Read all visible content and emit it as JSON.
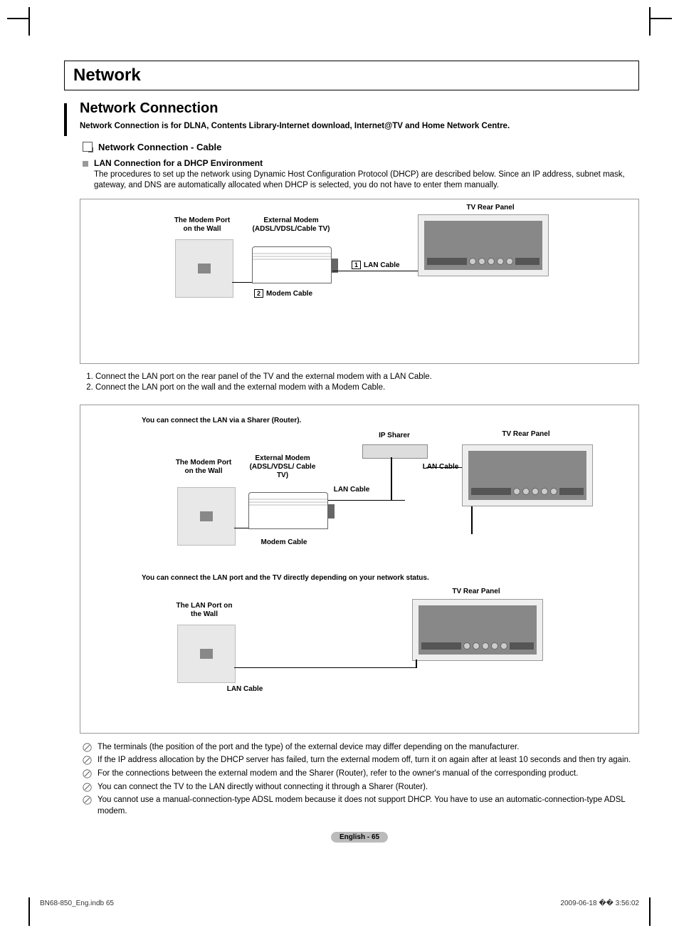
{
  "section": {
    "title": "Network"
  },
  "subsection": {
    "title": "Network Connection",
    "description": "Network Connection is for DLNA, Contents Library-Internet download, Internet@TV and Home Network Centre."
  },
  "cable_section": {
    "title": "Network Connection - Cable",
    "lan_dhcp_title": "LAN Connection for a DHCP Environment",
    "lan_dhcp_body": "The procedures to set up the network using Dynamic Host Configuration Protocol (DHCP) are described below. Since an IP address, subnet mask, gateway, and DNS are automatically allocated when DHCP is selected, you do not have to enter them manually."
  },
  "diagram1": {
    "modem_port_label": "The Modem Port on the Wall",
    "external_modem_label": "External Modem (ADSL/VDSL/Cable TV)",
    "tv_rear_label": "TV Rear Panel",
    "lan_cable_num": "1",
    "lan_cable_label": "LAN Cable",
    "modem_cable_num": "2",
    "modem_cable_label": "Modem Cable"
  },
  "steps": {
    "s1_num": "1.",
    "s1": "Connect the LAN port on the rear panel of the TV and the external modem with a LAN Cable.",
    "s2_num": "2.",
    "s2": "Connect the LAN port on the wall and the external modem with a Modem Cable."
  },
  "diagram2": {
    "caption1": "You can connect the LAN via a Sharer (Router).",
    "modem_port_label": "The Modem Port on the Wall",
    "external_modem_label": "External Modem (ADSL/VDSL/ Cable TV)",
    "ip_sharer_label": "IP Sharer",
    "tv_rear_label": "TV Rear Panel",
    "lan_cable_label": "LAN Cable",
    "modem_cable_label": "Modem Cable",
    "caption2": "You can connect the LAN port and the TV directly depending on your network status.",
    "lan_port_label": "The LAN Port on the Wall",
    "lan_cable_label2": "LAN Cable",
    "tv_rear_label2": "TV Rear Panel"
  },
  "notes": {
    "n1": "The terminals (the position of the port and the type) of the external device may differ depending on the manufacturer.",
    "n2": "If the IP address allocation by the DHCP server has failed, turn the external modem off, turn it on again after at least 10 seconds and then try again.",
    "n3": "For the connections between the external modem and the Sharer (Router), refer to the owner's manual of the corresponding product.",
    "n4": "You can connect the TV to the LAN directly without connecting it through a Sharer (Router).",
    "n5": "You cannot use a manual-connection-type ADSL modem because it does not support DHCP. You have to use an automatic-connection-type ADSL modem."
  },
  "footer": {
    "page_label": "English - 65"
  },
  "docfooter": {
    "left": "BN68-850_Eng.indb   65",
    "right": "2009-06-18   �� 3:56:02"
  }
}
